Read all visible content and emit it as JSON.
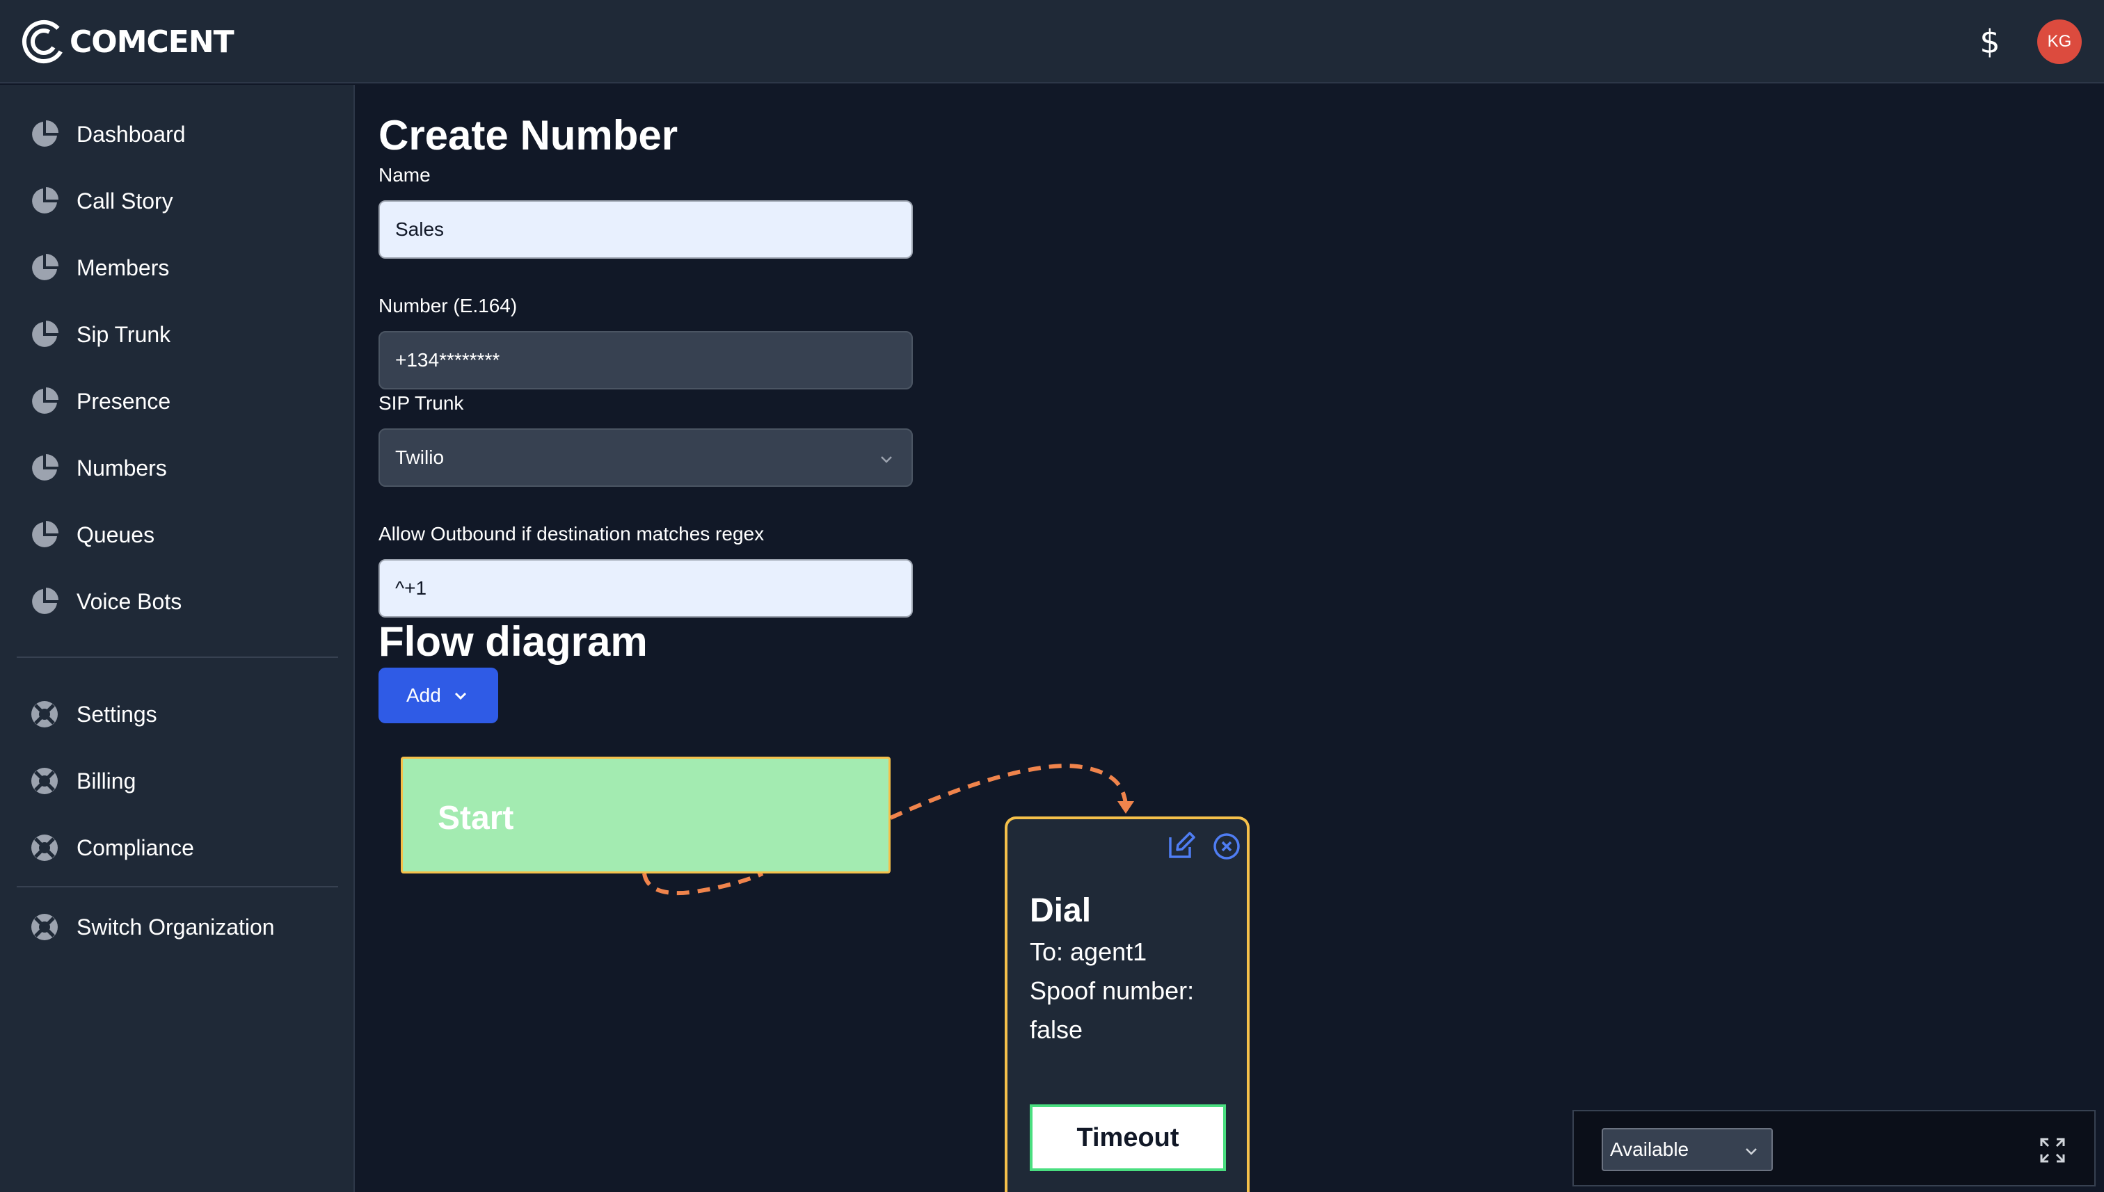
{
  "app": {
    "logo_text": "COMCENT",
    "currency_symbol": "$",
    "avatar_initials": "KG",
    "avatar_color": "#dc4b3e",
    "accent_color": "#2f5be6"
  },
  "sidebar": {
    "items": [
      {
        "label": "Dashboard",
        "icon": "pie-chart-icon"
      },
      {
        "label": "Call Story",
        "icon": "pie-chart-icon"
      },
      {
        "label": "Members",
        "icon": "pie-chart-icon"
      },
      {
        "label": "Sip Trunk",
        "icon": "pie-chart-icon"
      },
      {
        "label": "Presence",
        "icon": "pie-chart-icon"
      },
      {
        "label": "Numbers",
        "icon": "pie-chart-icon"
      },
      {
        "label": "Queues",
        "icon": "pie-chart-icon"
      },
      {
        "label": "Voice Bots",
        "icon": "pie-chart-icon"
      }
    ],
    "secondary": [
      {
        "label": "Settings",
        "icon": "life-ring-icon"
      },
      {
        "label": "Billing",
        "icon": "life-ring-icon"
      },
      {
        "label": "Compliance",
        "icon": "life-ring-icon"
      }
    ],
    "footer": [
      {
        "label": "Switch Organization",
        "icon": "life-ring-icon"
      }
    ]
  },
  "form": {
    "title": "Create Number",
    "name_label": "Name",
    "name_value": "Sales",
    "number_label": "Number (E.164)",
    "number_value": "+134********",
    "sip_label": "SIP Trunk",
    "sip_value": "Twilio",
    "regex_label": "Allow Outbound if destination matches regex",
    "regex_value": "^+1"
  },
  "flow": {
    "title": "Flow diagram",
    "add_label": "Add",
    "start_label": "Start",
    "dial": {
      "title": "Dial",
      "to": "To: agent1",
      "spoof_label": "Spoof number:",
      "spoof_value": "false",
      "timeout_label": "Timeout"
    },
    "edge_color": "#f0844c"
  },
  "status": {
    "selected": "Available"
  }
}
